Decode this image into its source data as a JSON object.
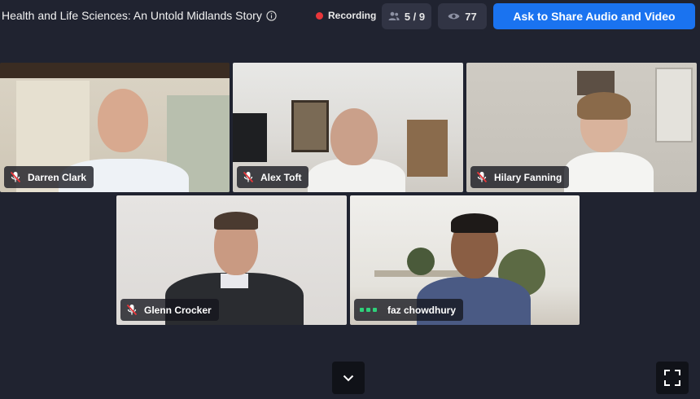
{
  "header": {
    "title": "Health and Life Sciences: An Untold Midlands Story",
    "info_icon": "info-icon",
    "recording_label": "Recording",
    "participants_count": "5 / 9",
    "viewers_count": "77",
    "share_button_label": "Ask to Share Audio and Video"
  },
  "participants": [
    {
      "name": "Darren Clark",
      "mic": "muted"
    },
    {
      "name": "Alex Toft",
      "mic": "muted"
    },
    {
      "name": "Hilary Fanning",
      "mic": "muted"
    },
    {
      "name": "Glenn Crocker",
      "mic": "muted"
    },
    {
      "name": "faz chowdhury",
      "mic": "speaking"
    }
  ],
  "controls": {
    "expand_icon": "chevron-down-icon",
    "fullscreen_icon": "fullscreen-icon"
  },
  "colors": {
    "background": "#202330",
    "accent": "#1a73f0",
    "recording": "#e8363a",
    "speaking": "#2fd17a"
  }
}
